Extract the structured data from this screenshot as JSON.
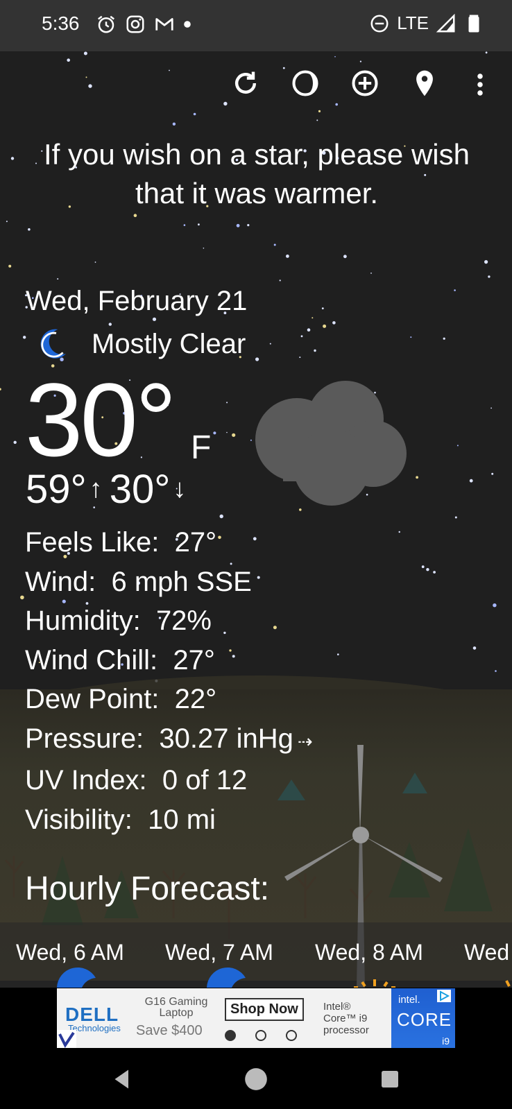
{
  "status_bar": {
    "time": "5:36",
    "network": "LTE",
    "left_icons": [
      "alarm-icon",
      "instagram-icon",
      "gmail-icon",
      "dot-icon"
    ],
    "right_icons": [
      "do-not-disturb-icon",
      "signal-icon",
      "battery-icon"
    ]
  },
  "toolbar": {
    "icons": [
      "refresh-icon",
      "moon-phase-icon",
      "add-location-icon",
      "location-pin-icon",
      "more-vert-icon"
    ]
  },
  "quote": "If you wish on a star, please wish that it was warmer.",
  "current": {
    "date": "Wed, February 21",
    "condition": "Mostly Clear",
    "temperature": "30°",
    "unit": "F",
    "high": "59°",
    "high_arrow": "↑",
    "low": "30°",
    "low_arrow": "↓"
  },
  "details": [
    {
      "label": "Feels Like:",
      "value": "27°"
    },
    {
      "label": "Wind:",
      "value": "6 mph SSE"
    },
    {
      "label": "Humidity:",
      "value": "72%"
    },
    {
      "label": "Wind Chill:",
      "value": "27°"
    },
    {
      "label": "Dew Point:",
      "value": "22°"
    },
    {
      "label": "Pressure:",
      "value": "30.27 inHg",
      "trend": "⇢"
    },
    {
      "label": "UV Index:",
      "value": "0 of 12"
    },
    {
      "label": "Visibility:",
      "value": "10 mi"
    }
  ],
  "hourly": {
    "title": "Hourly Forecast:",
    "items": [
      {
        "label": "Wed, 6 AM"
      },
      {
        "label": "Wed, 7 AM"
      },
      {
        "label": "Wed, 8 AM"
      },
      {
        "label": "Wed"
      }
    ]
  },
  "ad": {
    "brand": "DELL",
    "brand_sub": "Technologies",
    "product": "G16 Gaming Laptop",
    "offer": "Save $400",
    "cta": "Shop Now",
    "processor": "Intel® Core™ i9 processor",
    "intel_logo": "intel.",
    "core": "CORE",
    "core_tier": "i9",
    "carousel_active": 1
  },
  "colors": {
    "accent_moon": "#1e66d6",
    "sky": "#1f1f1f",
    "status_bar": "#333333"
  }
}
